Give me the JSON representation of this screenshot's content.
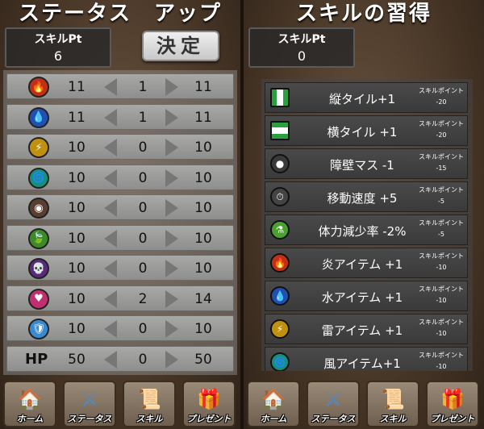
{
  "left": {
    "title": "ステータス　アップ",
    "skill_pt_label": "スキルPt",
    "skill_pt_value": "6",
    "decide_label": "決定",
    "stats": [
      {
        "icon": "fire-element-icon",
        "color": "#c03018",
        "glyph": "🔥",
        "base": "11",
        "add": "1",
        "total": "11"
      },
      {
        "icon": "water-element-icon",
        "color": "#2050b0",
        "glyph": "💧",
        "base": "11",
        "add": "1",
        "total": "11"
      },
      {
        "icon": "thunder-element-icon",
        "color": "#c09010",
        "glyph": "⚡",
        "base": "10",
        "add": "0",
        "total": "10"
      },
      {
        "icon": "wind-element-icon",
        "color": "#189078",
        "glyph": "🌀",
        "base": "10",
        "add": "0",
        "total": "10"
      },
      {
        "icon": "earth-element-icon",
        "color": "#5a3e30",
        "glyph": "◉",
        "base": "10",
        "add": "0",
        "total": "10"
      },
      {
        "icon": "leaf-element-icon",
        "color": "#3e8a28",
        "glyph": "🍃",
        "base": "10",
        "add": "0",
        "total": "10"
      },
      {
        "icon": "skull-element-icon",
        "color": "#5a2a7a",
        "glyph": "💀",
        "base": "10",
        "add": "0",
        "total": "10"
      },
      {
        "icon": "heart-element-icon",
        "color": "#c03070",
        "glyph": "♥",
        "base": "10",
        "add": "2",
        "total": "14"
      },
      {
        "icon": "shield-icon",
        "color": "#3a8ad0",
        "glyph": "🛡",
        "base": "10",
        "add": "0",
        "total": "10"
      }
    ],
    "hp": {
      "label": "HP",
      "base": "50",
      "add": "0",
      "total": "50"
    }
  },
  "right": {
    "title": "スキルの習得",
    "skill_pt_label": "スキルPt",
    "skill_pt_value": "0",
    "skills": [
      {
        "icon": "vertical-tile-icon",
        "color": "#ffffff",
        "glyph": "",
        "name": "縦タイル+1",
        "cost_label": "スキルポイント",
        "cost": "-20"
      },
      {
        "icon": "horizontal-tile-icon",
        "color": "#ffffff",
        "glyph": "",
        "name": "横タイル +1",
        "cost_label": "スキルポイント",
        "cost": "-20"
      },
      {
        "icon": "rock-wall-icon",
        "color": "#3a3a3a",
        "glyph": "●",
        "name": "障壁マス -1",
        "cost_label": "スキルポイント",
        "cost": "-15"
      },
      {
        "icon": "stopwatch-icon",
        "color": "#444444",
        "glyph": "⏱",
        "name": "移動速度 +5",
        "cost_label": "スキルポイント",
        "cost": "-5"
      },
      {
        "icon": "potion-icon",
        "color": "#4aa030",
        "glyph": "⚗",
        "name": "体力減少率 -2%",
        "cost_label": "スキルポイント",
        "cost": "-5"
      },
      {
        "icon": "fire-element-icon",
        "color": "#c03018",
        "glyph": "🔥",
        "name": "炎アイテム +1",
        "cost_label": "スキルポイント",
        "cost": "-10"
      },
      {
        "icon": "water-element-icon",
        "color": "#2050b0",
        "glyph": "💧",
        "name": "水アイテム +1",
        "cost_label": "スキルポイント",
        "cost": "-10"
      },
      {
        "icon": "thunder-element-icon",
        "color": "#c09010",
        "glyph": "⚡",
        "name": "雷アイテム +1",
        "cost_label": "スキルポイント",
        "cost": "-10"
      },
      {
        "icon": "wind-element-icon",
        "color": "#189078",
        "glyph": "🌀",
        "name": "風アイテム+1",
        "cost_label": "スキルポイント",
        "cost": "-10"
      }
    ]
  },
  "nav": [
    {
      "name": "home",
      "label": "ホーム",
      "icon": "house-icon",
      "glyph": "🏠",
      "color": "#c05040"
    },
    {
      "name": "status",
      "label": "ステータス",
      "icon": "crossed-swords-icon",
      "glyph": "⚔",
      "color": "#4a8ad0"
    },
    {
      "name": "skill",
      "label": "スキル",
      "icon": "scroll-icon",
      "glyph": "📜",
      "color": "#d8c090"
    },
    {
      "name": "present",
      "label": "プレゼント",
      "icon": "treasure-chest-icon",
      "glyph": "🎁",
      "color": "#a87020"
    }
  ]
}
